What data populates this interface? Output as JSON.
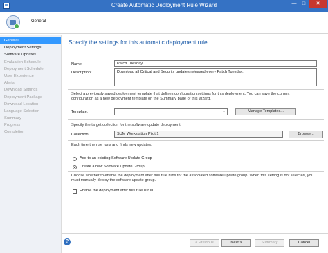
{
  "window": {
    "title": "Create Automatic Deployment Rule Wizard",
    "controls": {
      "minimize": "—",
      "maximize": "□",
      "close": "✕"
    }
  },
  "header": {
    "label": "General",
    "icon": "wizard-computer-icon"
  },
  "sidebar": {
    "items": [
      {
        "label": "General",
        "state": "active"
      },
      {
        "label": "Deployment Settings",
        "state": "done"
      },
      {
        "label": "Software Updates",
        "state": "done"
      },
      {
        "label": "Evaluation Schedule",
        "state": "pending"
      },
      {
        "label": "Deployment Schedule",
        "state": "pending"
      },
      {
        "label": "User Experience",
        "state": "pending"
      },
      {
        "label": "Alerts",
        "state": "pending"
      },
      {
        "label": "Download Settings",
        "state": "pending"
      },
      {
        "label": "Deployment Package",
        "state": "pending"
      },
      {
        "label": "Download Location",
        "state": "pending"
      },
      {
        "label": "Language Selection",
        "state": "pending"
      },
      {
        "label": "Summary",
        "state": "pending"
      },
      {
        "label": "Progress",
        "state": "pending"
      },
      {
        "label": "Completion",
        "state": "pending"
      }
    ]
  },
  "main": {
    "heading": "Specify the settings for this automatic deployment rule",
    "name_label": "Name:",
    "name_value": "Patch Tuesday",
    "description_label": "Description:",
    "description_value": "Download all Critical and Security updates released every Patch Tuesday.",
    "template_info_line1": "Select a previously saved deployment template that defines configuration settings for this deployment. You can save the current",
    "template_info_line2": "configuration as a new deployment template on the Summary page of this wizard.",
    "template_label": "Template:",
    "template_value": "",
    "manage_templates_button": "Manage Templates...",
    "collection_info": "Specify the target collection for the software update deployment.",
    "collection_label": "Collection:",
    "collection_value": "SUM Workstation Pilot 1",
    "browse_button": "Browse...",
    "run_info": "Each time the rule runs and finds new updates:",
    "option_existing": "Add to an existing Software Update Group",
    "option_new": "Create a new Software Update Group",
    "selected_option": "new",
    "enable_info_line1": "Choose whether to enable the deployment after this rule runs for the associated software update group. When this setting is not selected, you",
    "enable_info_line2": "must manually deploy the software update group.",
    "enable_checkbox_label": "Enable the deployment after this rule is run",
    "enable_checked": false
  },
  "footer": {
    "previous": "< Previous",
    "next": "Next >",
    "summary": "Summary",
    "cancel": "Cancel",
    "help": "?"
  },
  "colors": {
    "titlebar": "#3572c4",
    "heading": "#1a5aa8",
    "nav_active": "#3399ff",
    "close_button": "#c7372f"
  }
}
